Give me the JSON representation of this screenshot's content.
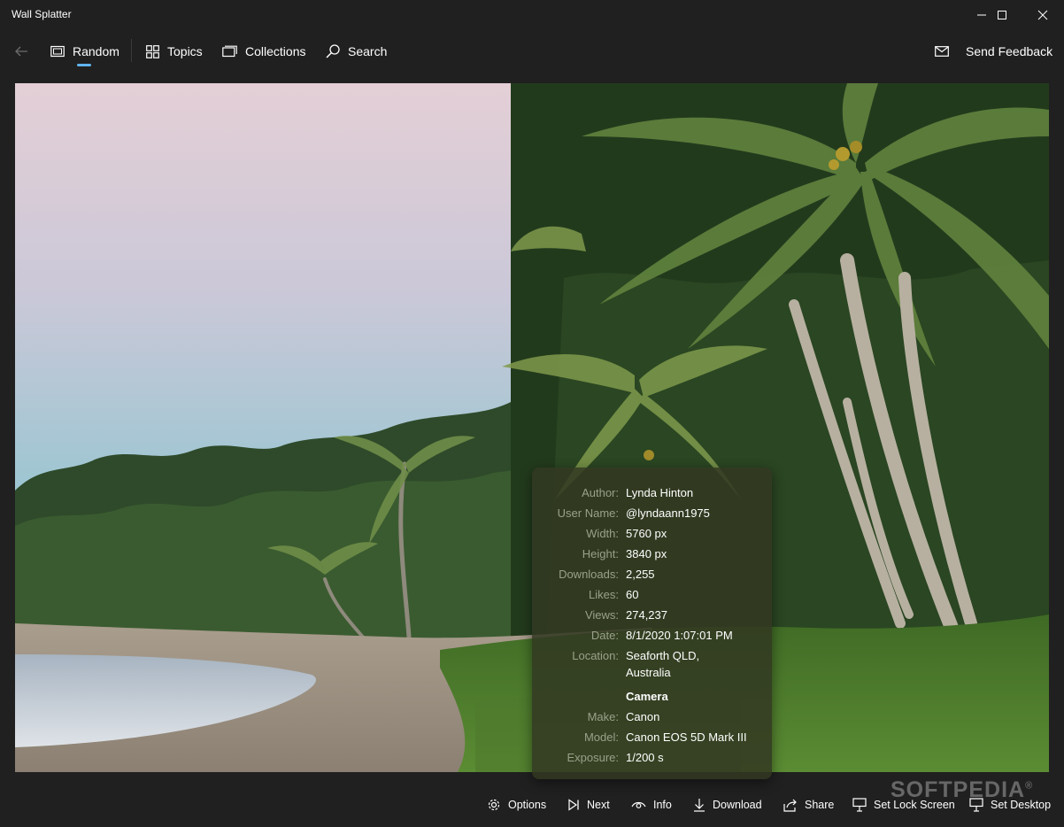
{
  "window": {
    "title": "Wall Splatter",
    "controls": [
      "minimize-icon",
      "maximize-icon",
      "close-icon"
    ]
  },
  "nav": {
    "back_icon": "back-arrow-icon",
    "items": [
      {
        "label": "Random",
        "icon": "random-icon",
        "selected": true
      },
      {
        "label": "Topics",
        "icon": "grid-icon"
      },
      {
        "label": "Collections",
        "icon": "collections-icon"
      },
      {
        "label": "Search",
        "icon": "search-icon"
      }
    ],
    "feedback": {
      "label": "Send Feedback",
      "icon": "mail-icon"
    },
    "accent_color": "#60b4f0"
  },
  "photo": {
    "details": [
      {
        "label": "Author:",
        "value": "Lynda Hinton"
      },
      {
        "label": "User Name:",
        "value": "@lyndaann1975"
      },
      {
        "label": "Width:",
        "value": "5760 px"
      },
      {
        "label": "Height:",
        "value": "3840 px"
      },
      {
        "label": "Downloads:",
        "value": "2,255"
      },
      {
        "label": "Likes:",
        "value": "60"
      },
      {
        "label": "Views:",
        "value": "274,237"
      },
      {
        "label": "Date:",
        "value": "8/1/2020 1:07:01 PM"
      },
      {
        "label": "Location:",
        "value": "Seaforth QLD,",
        "value2": "Australia"
      }
    ],
    "camera_heading": "Camera",
    "camera": [
      {
        "label": "Make:",
        "value": "Canon"
      },
      {
        "label": "Model:",
        "value": "Canon EOS 5D Mark III"
      },
      {
        "label": "Exposure:",
        "value": "1/200 s"
      }
    ]
  },
  "commands": [
    {
      "label": "Options",
      "icon": "gear-icon"
    },
    {
      "label": "Next",
      "icon": "next-icon"
    },
    {
      "label": "Info",
      "icon": "eye-icon"
    },
    {
      "label": "Download",
      "icon": "download-icon"
    },
    {
      "label": "Share",
      "icon": "share-icon"
    },
    {
      "label": "Set Lock Screen",
      "icon": "lock-screen-icon"
    },
    {
      "label": "Set Desktop",
      "icon": "desktop-icon"
    }
  ],
  "watermark": {
    "text": "SOFTPEDIA",
    "mark": "®"
  }
}
